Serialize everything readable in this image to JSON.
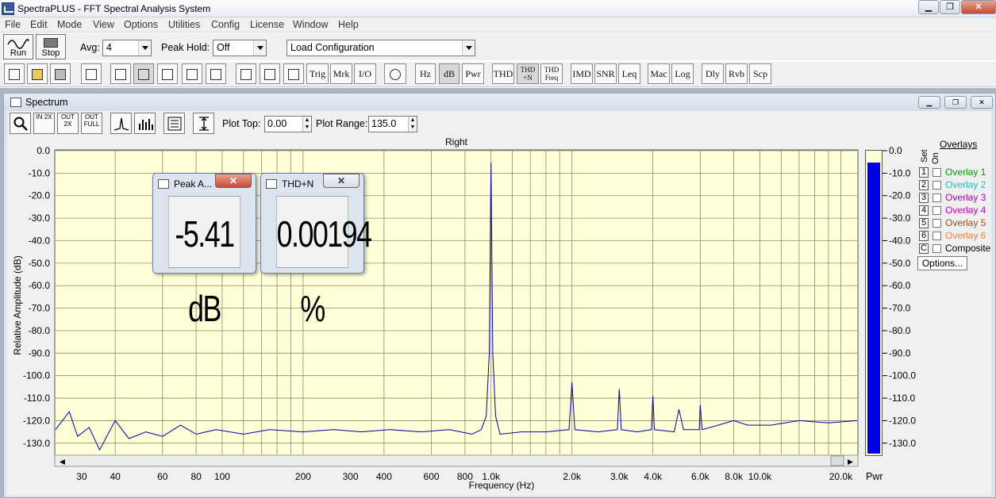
{
  "window": {
    "title": "SpectraPLUS - FFT Spectral Analysis System",
    "min": "▁",
    "max": "❐",
    "close": "✕"
  },
  "menu": [
    "File",
    "Edit",
    "Mode",
    "View",
    "Options",
    "Utilities",
    "Config",
    "License",
    "Window",
    "Help"
  ],
  "toolbar1": {
    "run_label": "Run",
    "stop_label": "Stop",
    "avg_label": "Avg:",
    "avg_value": "4",
    "peak_hold_label": "Peak Hold:",
    "peak_hold_value": "Off",
    "config_value": "Load Configuration"
  },
  "toolbar2": {
    "text_buttons": [
      "Trig",
      "Mrk",
      "I/O",
      "Hz",
      "dB",
      "Pwr",
      "THD",
      "THD +N",
      "THD Freq",
      "IMD",
      "SNR",
      "Leq",
      "Mac",
      "Log",
      "Dly",
      "Rvb",
      "Scp"
    ]
  },
  "spectrum": {
    "title": "Spectrum",
    "zoom_in": "IN 2X",
    "zoom_out": "OUT 2X",
    "zoom_full": "OUT FULL",
    "plot_top_label": "Plot Top:",
    "plot_top_value": "0.00",
    "plot_range_label": "Plot Range:",
    "plot_range_value": "135.0",
    "channel": "Right"
  },
  "popups": [
    {
      "title": "Peak A...",
      "value": "-5.41 dB"
    },
    {
      "title": "THD+N",
      "value": "0.00194 %"
    }
  ],
  "overlays": {
    "header": "Overlays",
    "set_label": "Set",
    "on_label": "On",
    "items": [
      {
        "num": "1",
        "name": "Overlay 1",
        "color": "#00a000"
      },
      {
        "num": "2",
        "name": "Overlay 2",
        "color": "#20c0c0"
      },
      {
        "num": "3",
        "name": "Overlay 3",
        "color": "#b000b0"
      },
      {
        "num": "4",
        "name": "Overlay 4",
        "color": "#c000c0"
      },
      {
        "num": "5",
        "name": "Overlay 5",
        "color": "#a05020"
      },
      {
        "num": "6",
        "name": "Overlay 6",
        "color": "#f08040"
      },
      {
        "num": "C",
        "name": "Composite",
        "color": "#000000"
      }
    ],
    "options_label": "Options..."
  },
  "pwr": {
    "label": "Pwr",
    "level_db": -5.41
  },
  "chart_data": {
    "type": "line",
    "title": "Right",
    "xlabel": "Frequency (Hz)",
    "ylabel": "Relative Amplitude (dB)",
    "xscale": "log",
    "xlim": [
      24,
      23000
    ],
    "ylim": [
      -135,
      0
    ],
    "x_ticks": [
      {
        "v": 30,
        "t": "30"
      },
      {
        "v": 40,
        "t": "40"
      },
      {
        "v": 60,
        "t": "60"
      },
      {
        "v": 80,
        "t": "80"
      },
      {
        "v": 100,
        "t": "100"
      },
      {
        "v": 200,
        "t": "200"
      },
      {
        "v": 300,
        "t": "300"
      },
      {
        "v": 400,
        "t": "400"
      },
      {
        "v": 600,
        "t": "600"
      },
      {
        "v": 800,
        "t": "800"
      },
      {
        "v": 1000,
        "t": "1.0k"
      },
      {
        "v": 2000,
        "t": "2.0k"
      },
      {
        "v": 3000,
        "t": "3.0k"
      },
      {
        "v": 4000,
        "t": "4.0k"
      },
      {
        "v": 6000,
        "t": "6.0k"
      },
      {
        "v": 8000,
        "t": "8.0k"
      },
      {
        "v": 10000,
        "t": "10.0k"
      },
      {
        "v": 20000,
        "t": "20.0k"
      }
    ],
    "y_ticks": [
      0,
      -10,
      -20,
      -30,
      -40,
      -50,
      -60,
      -70,
      -80,
      -90,
      -100,
      -110,
      -120,
      -130
    ],
    "y_tick_labels": [
      "0.0",
      "-10.0",
      "-20.0",
      "-30.0",
      "-40.0",
      "-50.0",
      "-60.0",
      "-70.0",
      "-80.0",
      "-90.0",
      "-100.0",
      "-110.0",
      "-120.0",
      "-130.0"
    ],
    "grid": true,
    "series": [
      {
        "color": "#0000a0",
        "points": [
          [
            24,
            -124
          ],
          [
            27,
            -116
          ],
          [
            29,
            -127
          ],
          [
            32,
            -123
          ],
          [
            35,
            -133
          ],
          [
            40,
            -120
          ],
          [
            45,
            -128
          ],
          [
            52,
            -125
          ],
          [
            60,
            -127
          ],
          [
            70,
            -122
          ],
          [
            80,
            -126
          ],
          [
            95,
            -124
          ],
          [
            120,
            -126
          ],
          [
            150,
            -124
          ],
          [
            200,
            -125
          ],
          [
            260,
            -124
          ],
          [
            330,
            -125
          ],
          [
            420,
            -124
          ],
          [
            550,
            -125
          ],
          [
            700,
            -124
          ],
          [
            850,
            -126
          ],
          [
            920,
            -124
          ],
          [
            960,
            -118
          ],
          [
            985,
            -90
          ],
          [
            1000,
            -5.4
          ],
          [
            1015,
            -90
          ],
          [
            1040,
            -118
          ],
          [
            1080,
            -126
          ],
          [
            1300,
            -125
          ],
          [
            1600,
            -125
          ],
          [
            1950,
            -124
          ],
          [
            2000,
            -103
          ],
          [
            2050,
            -124
          ],
          [
            2500,
            -125
          ],
          [
            2950,
            -124
          ],
          [
            3000,
            -106
          ],
          [
            3050,
            -124
          ],
          [
            3500,
            -125
          ],
          [
            3950,
            -124
          ],
          [
            4000,
            -109
          ],
          [
            4050,
            -124
          ],
          [
            4800,
            -125
          ],
          [
            5000,
            -115
          ],
          [
            5200,
            -124
          ],
          [
            5950,
            -124
          ],
          [
            6000,
            -113
          ],
          [
            6100,
            -124
          ],
          [
            7000,
            -122
          ],
          [
            8000,
            -120
          ],
          [
            9000,
            -122
          ],
          [
            11000,
            -122
          ],
          [
            14000,
            -120
          ],
          [
            18000,
            -121
          ],
          [
            23000,
            -120
          ]
        ]
      }
    ]
  }
}
